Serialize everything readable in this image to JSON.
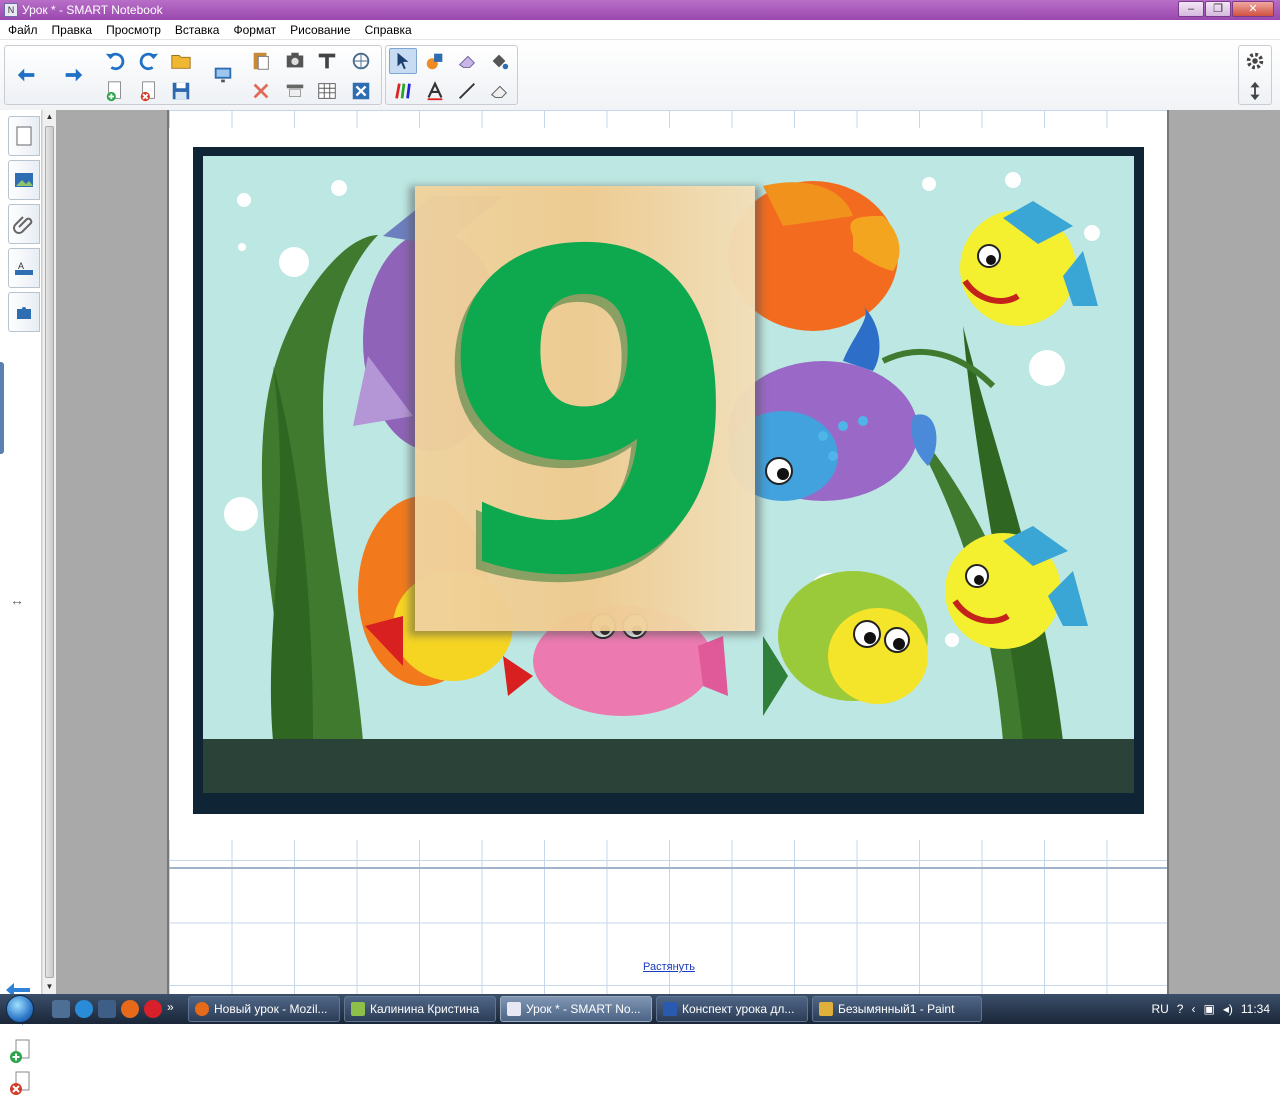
{
  "window": {
    "title": "Урок * - SMART Notebook",
    "icon_text": "N"
  },
  "menu": [
    "Файл",
    "Правка",
    "Просмотр",
    "Вставка",
    "Формат",
    "Рисование",
    "Справка"
  ],
  "toolbar": {
    "icons": [
      "back-arrow-icon",
      "forward-arrow-icon",
      "undo-icon",
      "redo-icon",
      "open-folder-icon",
      "add-page-icon",
      "delete-page-icon",
      "save-icon",
      "screen-shade-icon",
      "paste-icon",
      "screen-capture-icon",
      "text-tool-icon",
      "fill-icon",
      "delete-icon",
      "display-icon",
      "table-icon",
      "close-box-icon",
      "select-arrow-icon",
      "shapes-icon",
      "eraser-icon",
      "fill-bucket-icon",
      "pens-icon",
      "text-a-icon",
      "line-icon",
      "magic-eraser-icon",
      "settings-gear-icon",
      "move-toolbar-icon"
    ]
  },
  "sidebar": {
    "tabs": [
      "page-sorter-icon",
      "gallery-icon",
      "attachments-icon",
      "properties-icon",
      "addons-icon"
    ]
  },
  "canvas": {
    "digit": "9",
    "stretch_link": "Растянуть"
  },
  "colors": {
    "titlebar": "#a858bc",
    "digit_green": "#0ea84e",
    "water": "#bde7e2",
    "frame": "#0f2434"
  },
  "taskbar": {
    "items": [
      {
        "label": "Новый урок - Mozil...",
        "icon": "firefox-icon"
      },
      {
        "label": "Калинина Кристина",
        "icon": "notebook-icon"
      },
      {
        "label": "Урок * - SMART No...",
        "icon": "smart-notebook-icon"
      },
      {
        "label": "Конспект урока дл...",
        "icon": "word-icon"
      },
      {
        "label": "Безымянный1 - Paint",
        "icon": "paint-icon"
      }
    ],
    "language": "RU",
    "time": "11:34"
  }
}
